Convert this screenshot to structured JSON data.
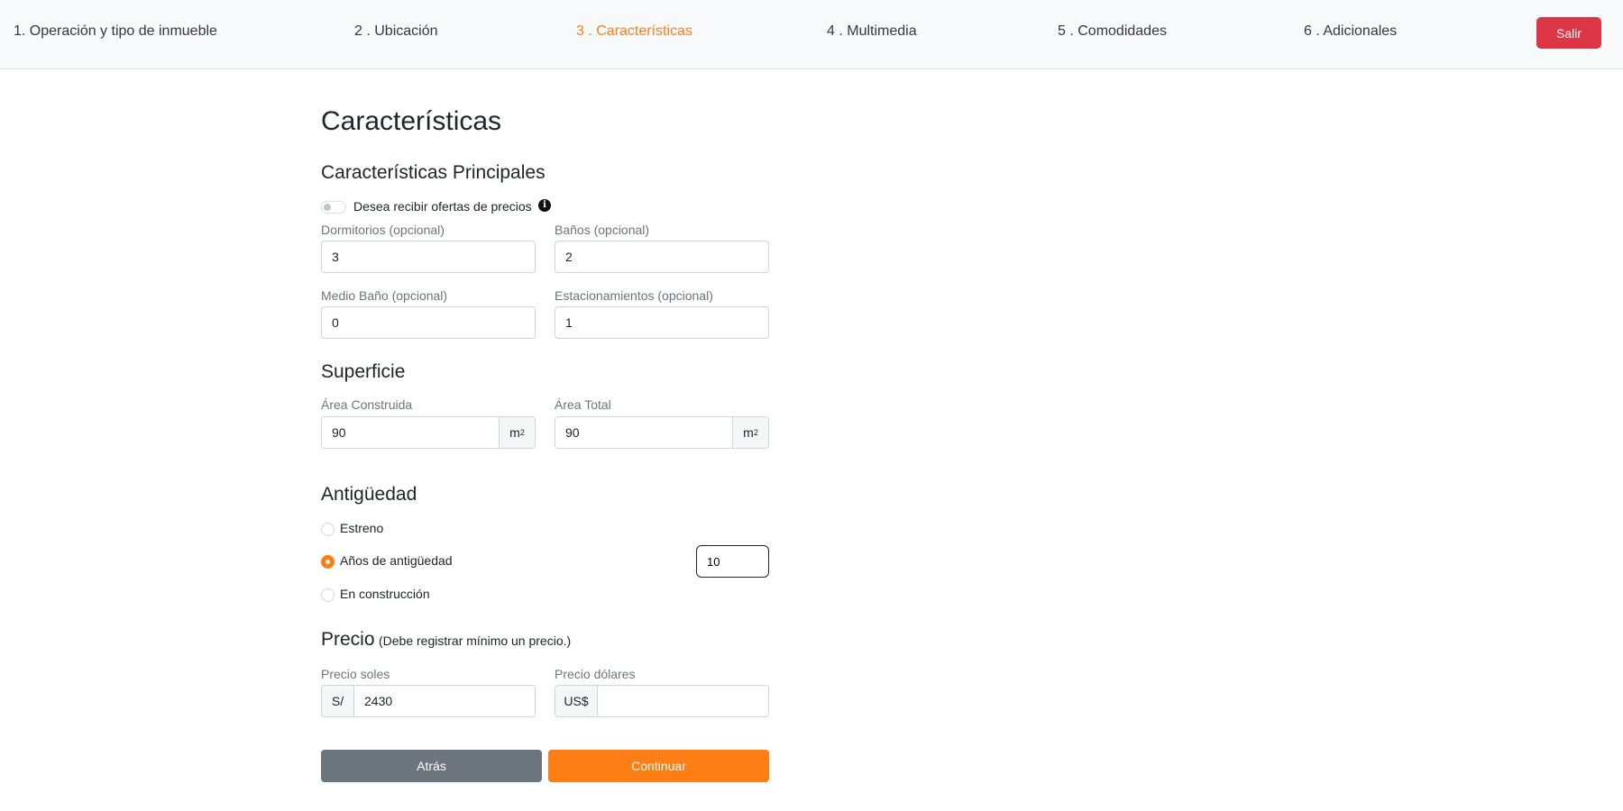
{
  "steps": [
    {
      "label": "1. Operación y tipo de inmueble"
    },
    {
      "label": "2 . Ubicación"
    },
    {
      "label": "3 . Características"
    },
    {
      "label": "4 . Multimedia"
    },
    {
      "label": "5 . Comodidades"
    },
    {
      "label": "6 . Adicionales"
    }
  ],
  "active_step": 3,
  "exit_label": "Salir",
  "page_title": "Características",
  "main": {
    "title": "Características Principales",
    "toggle_label": "Desea recibir ofertas de precios",
    "toggle_on": false,
    "fields": {
      "bedrooms": {
        "label": "Dormitorios (opcional)",
        "value": "3"
      },
      "bathrooms": {
        "label": "Baños (opcional)",
        "value": "2"
      },
      "half_bath": {
        "label": "Medio Baño (opcional)",
        "value": "0"
      },
      "parking": {
        "label": "Estacionamientos (opcional)",
        "value": "1"
      }
    }
  },
  "surface": {
    "title": "Superficie",
    "built": {
      "label": "Área Construida",
      "value": "90",
      "unit": "m",
      "unit_sup": "2"
    },
    "total": {
      "label": "Área Total",
      "value": "90",
      "unit": "m",
      "unit_sup": "2"
    }
  },
  "age": {
    "title": "Antigüedad",
    "options": [
      {
        "label": "Estreno",
        "checked": false
      },
      {
        "label": "Años de antigüedad",
        "checked": true
      },
      {
        "label": "En construcción",
        "checked": false
      }
    ],
    "years_value": "10"
  },
  "price": {
    "title": "Precio",
    "note": "(Debe registrar mínimo un precio.)",
    "soles": {
      "label": "Precio soles",
      "prefix": "S/",
      "value": "2430"
    },
    "dollars": {
      "label": "Precio dólares",
      "prefix": "US$",
      "value": ""
    }
  },
  "buttons": {
    "back": "Atrás",
    "next": "Continuar"
  },
  "colors": {
    "accent": "#fd7e14",
    "danger": "#dc3545",
    "secondary": "#6c757d"
  }
}
